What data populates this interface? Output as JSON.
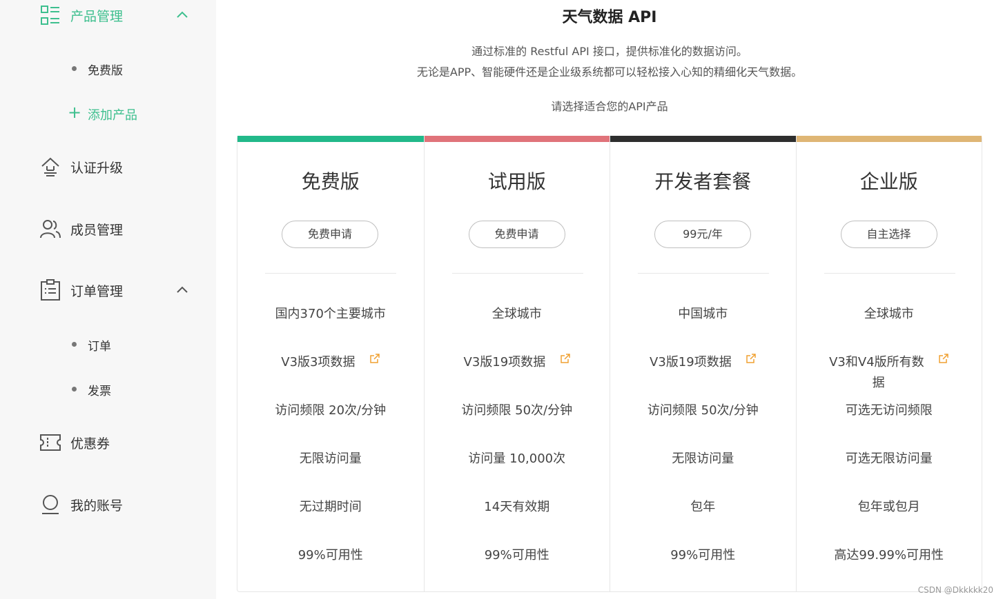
{
  "sidebar": {
    "product_mgmt": {
      "label": "产品管理"
    },
    "sub_free": "免费版",
    "add_product": "添加产品",
    "cert_upgrade": "认证升级",
    "member_mgmt": "成员管理",
    "order_mgmt": "订单管理",
    "sub_order": "订单",
    "sub_invoice": "发票",
    "coupon": "优惠券",
    "account": "我的账号"
  },
  "header": {
    "title": "天气数据 API",
    "desc_line1": "通过标准的 Restful API 接口，提供标准化的数据访问。",
    "desc_line2": "无论是APP、智能硬件还是企业级系统都可以轻松接入心知的精细化天气数据。",
    "choose": "请选择适合您的API产品"
  },
  "plans": [
    {
      "name": "免费版",
      "button": "免费申请",
      "color": "#22b98a",
      "coverage": "国内370个主要城市",
      "data": "V3版3项数据",
      "rate": "访问频限 20次/分钟",
      "volume": "无限访问量",
      "period": "无过期时间",
      "availability": "99%可用性"
    },
    {
      "name": "试用版",
      "button": "免费申请",
      "color": "#e0737a",
      "coverage": "全球城市",
      "data": "V3版19项数据",
      "rate": "访问频限 50次/分钟",
      "volume": "访问量 10,000次",
      "period": "14天有效期",
      "availability": "99%可用性"
    },
    {
      "name": "开发者套餐",
      "button": "99元/年",
      "color": "#2e2e2e",
      "coverage": "中国城市",
      "data": "V3版19项数据",
      "rate": "访问频限 50次/分钟",
      "volume": "无限访问量",
      "period": "包年",
      "availability": "99%可用性"
    },
    {
      "name": "企业版",
      "button": "自主选择",
      "color": "#dfb675",
      "coverage": "全球城市",
      "data_line1": "V3和V4版所有数",
      "data_line2": "据",
      "rate": "可选无访问频限",
      "volume": "可选无限访问量",
      "period": "包年或包月",
      "availability": "高达99.99%可用性"
    }
  ],
  "watermark": "CSDN @Dkkkkk20",
  "colors": {
    "accent": "#3dbf8e",
    "link_icon": "#f0a030"
  }
}
